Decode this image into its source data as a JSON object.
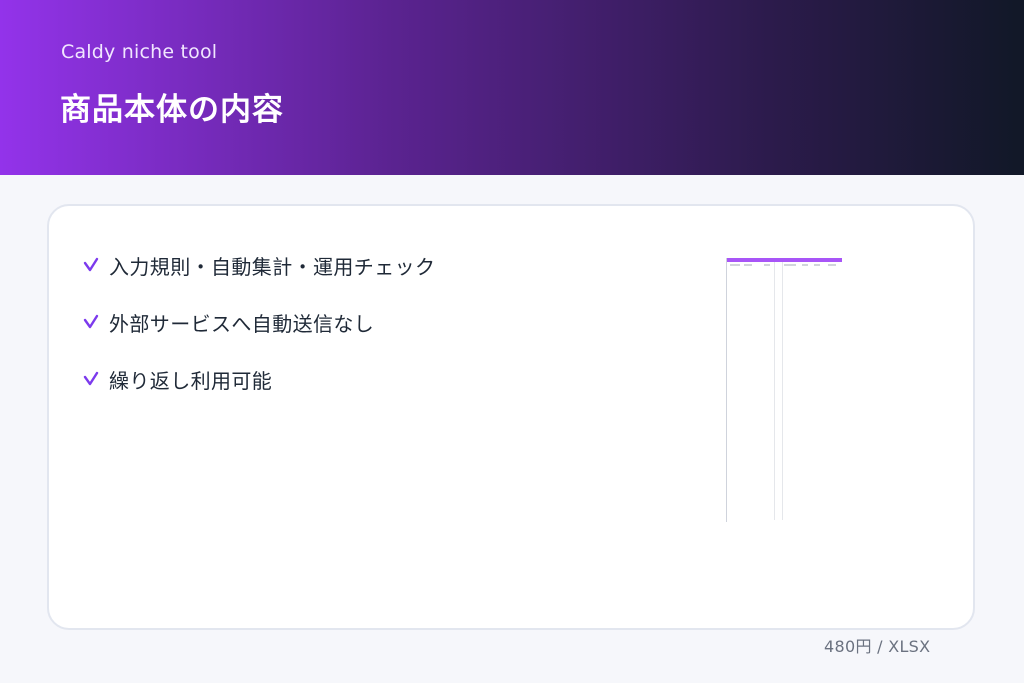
{
  "header": {
    "brand": "Caldy niche tool",
    "title": "商品本体の内容"
  },
  "colors": {
    "accent": "#9333ea",
    "header_dark": "#111827",
    "check": "#7c3aed"
  },
  "features": [
    {
      "icon": "check-icon",
      "text": "入力規則・自動集計・運用チェック"
    },
    {
      "icon": "check-icon",
      "text": "外部サービスへ自動送信なし"
    },
    {
      "icon": "check-icon",
      "text": "繰り返し利用可能"
    }
  ],
  "footer": {
    "meta": "480円 / XLSX"
  }
}
